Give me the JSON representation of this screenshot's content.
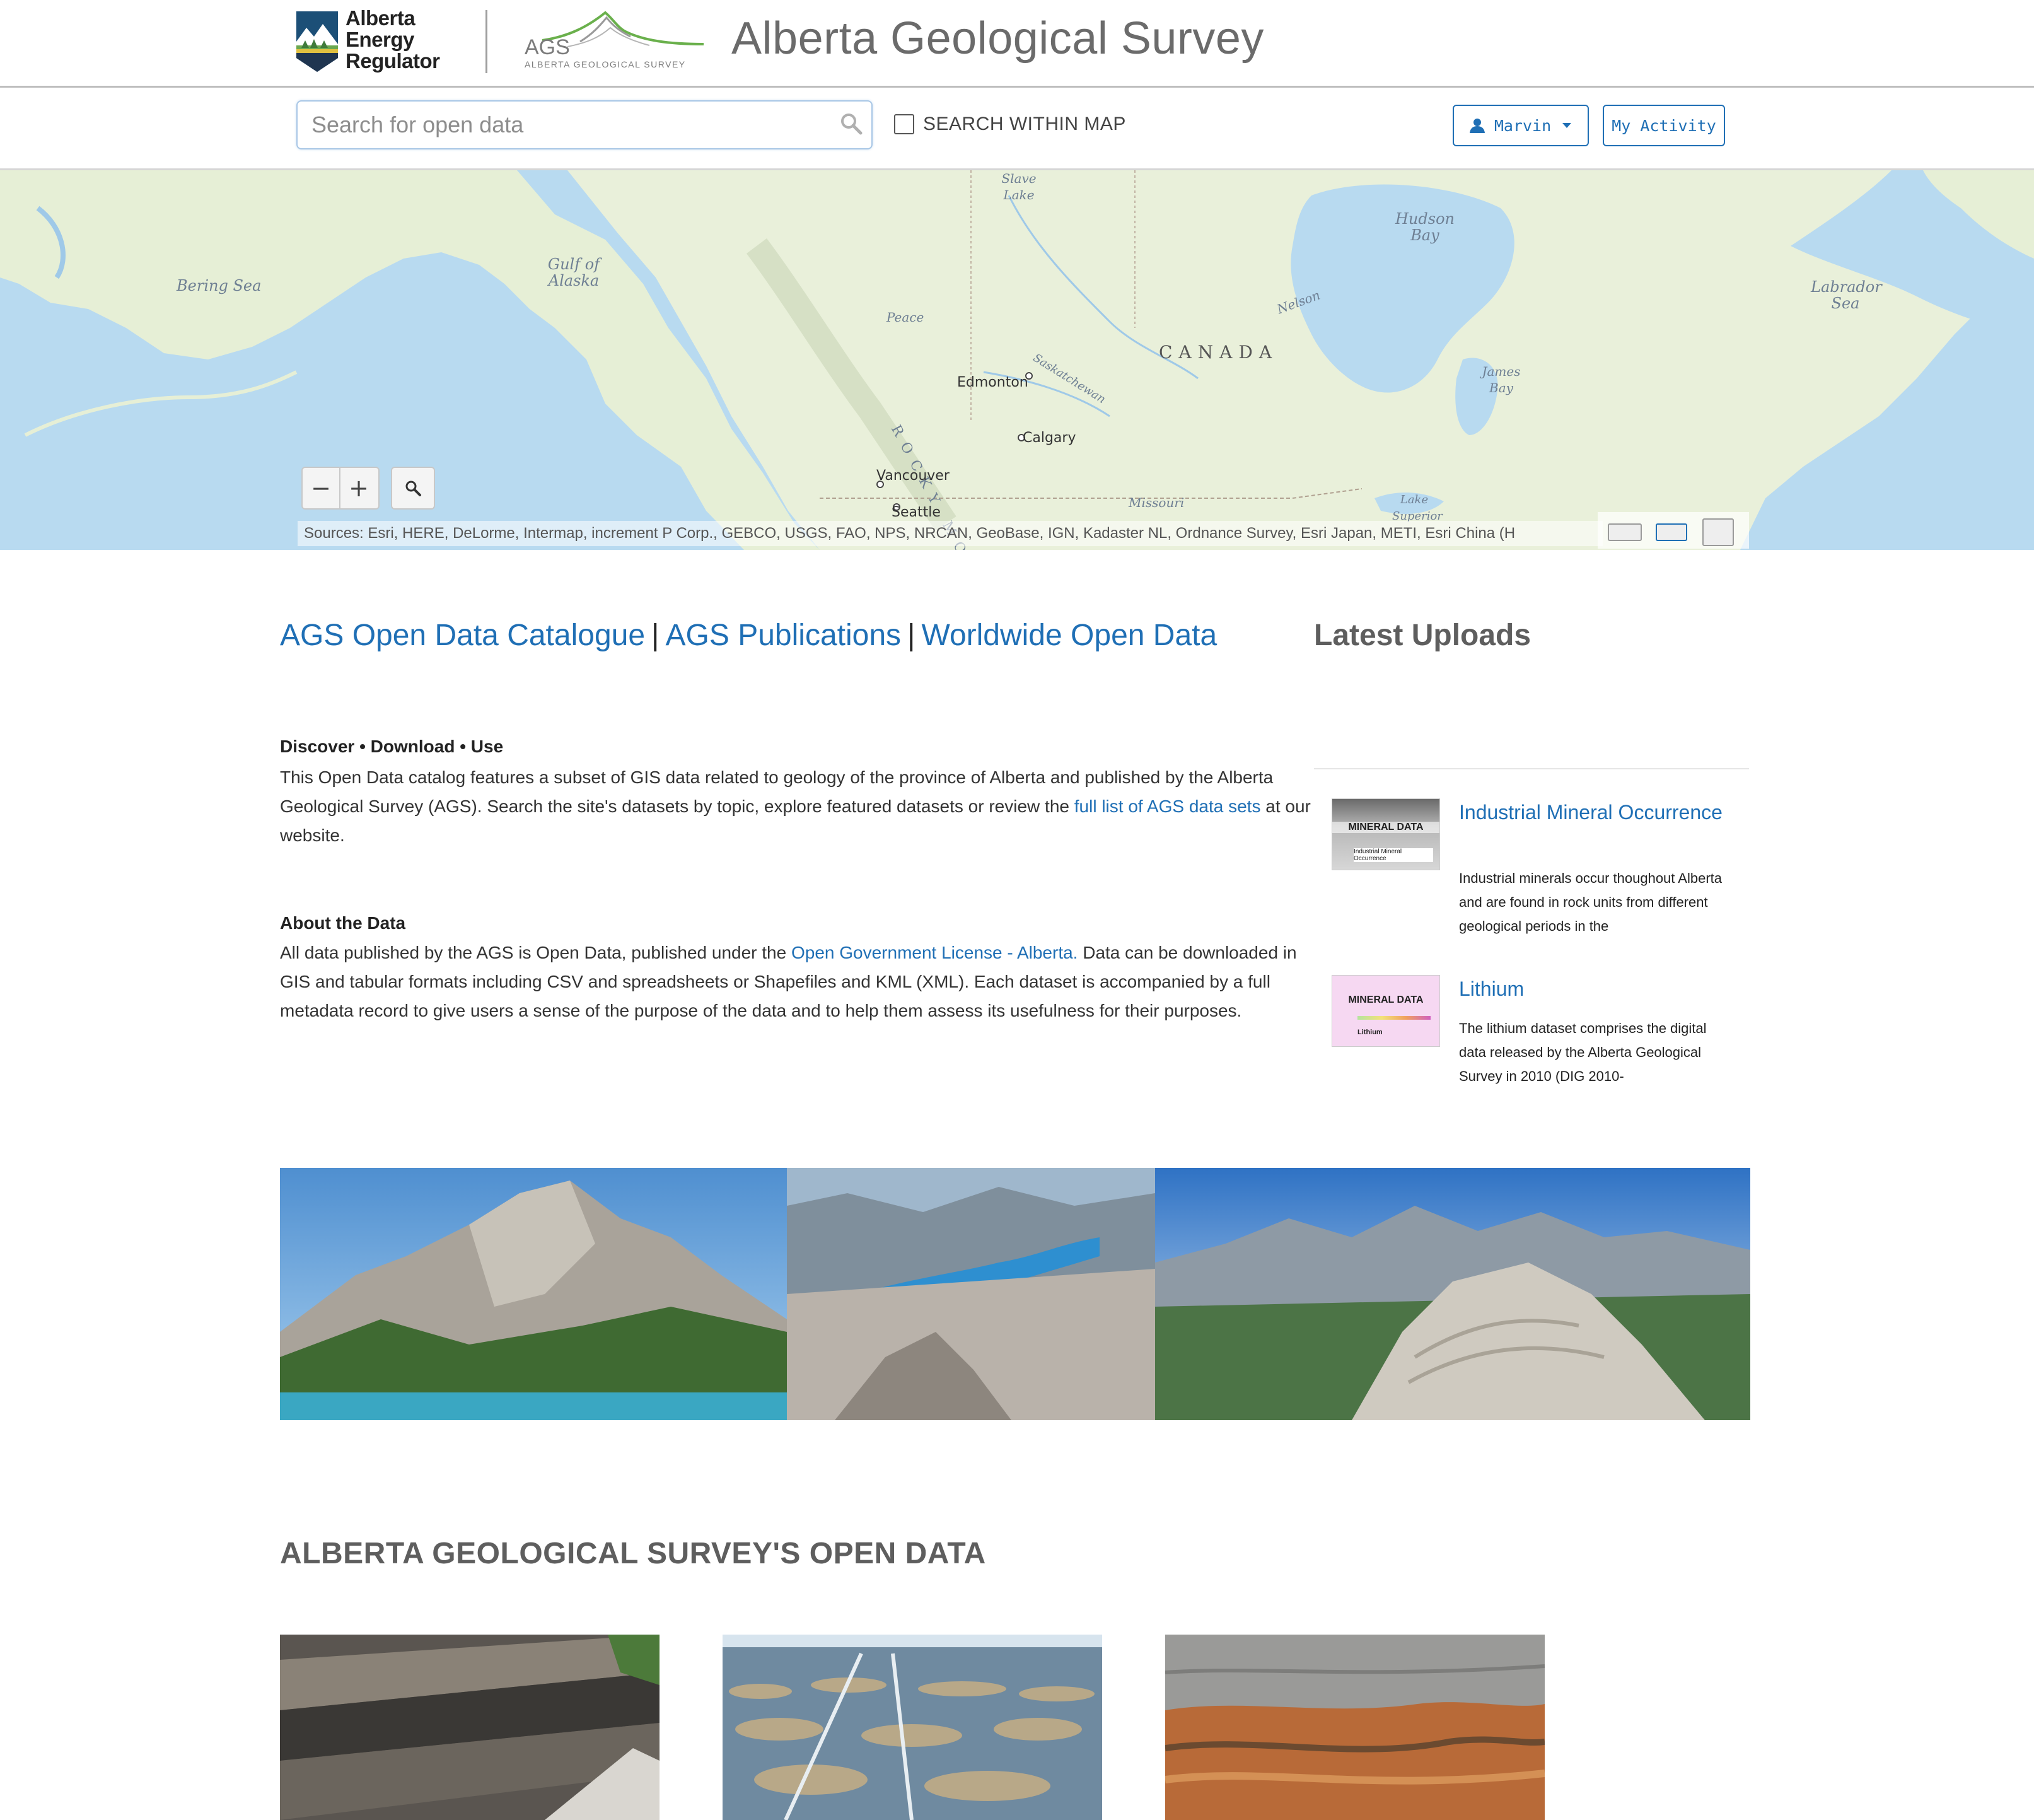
{
  "header": {
    "aer_logo_lines": [
      "Alberta",
      "Energy",
      "Regulator"
    ],
    "ags_logo_text": "AGS",
    "ags_logo_sub": "ALBERTA GEOLOGICAL SURVEY",
    "site_title": "Alberta Geological Survey"
  },
  "search": {
    "placeholder": "Search for open data",
    "within_map_label": "SEARCH WITHIN MAP",
    "within_map_checked": false,
    "user_button": "Marvin",
    "activity_button": "My Activity"
  },
  "map": {
    "labels": {
      "bering": "Bering Sea",
      "alaska": "Gulf of Alaska",
      "hudson": "Hudson Bay",
      "labrador": "Labrador Sea",
      "james": "James Bay",
      "country": "CANADA",
      "slave": "Slave Lake",
      "nelson": "Nelson",
      "peace": "Peace",
      "saskatchewan": "Saskatchewan",
      "missouri": "Missouri",
      "superior": "Lake Superior",
      "rocky": "ROCKY MO"
    },
    "cities": {
      "edmonton": "Edmonton",
      "calgary": "Calgary",
      "vancouver": "Vancouver",
      "seattle": "Seattle"
    },
    "zoom_out": "−",
    "zoom_in": "+",
    "attribution": "Sources: Esri, HERE, DeLorme, Intermap, increment P Corp., GEBCO, USGS, FAO, NPS, NRCAN, GeoBase, IGN, Kadaster NL, Ordnance Survey, Esri Japan, METI, Esri China (H"
  },
  "main": {
    "links": [
      "AGS Open Data Catalogue",
      "AGS Publications",
      "Worldwide Open Data"
    ],
    "link_separator": "|",
    "intro_heading": "Discover • Download • Use",
    "intro_text_1": "This Open Data catalog features a subset of GIS data related to geology of the province of Alberta and published by the Alberta Geological Survey (AGS). Search the site's datasets by topic, explore featured datasets or review the ",
    "intro_link": "full list of AGS data sets",
    "intro_text_2": " at our website.",
    "about_heading": "About the Data",
    "about_text_1": "All data published by the AGS is Open Data, published under the ",
    "about_link": "Open Government License - Alberta.",
    "about_text_2": " Data can be downloaded in GIS and tabular formats including CSV and spreadsheets or Shapefiles and KML (XML). Each dataset is accompanied by a full metadata record to give users a sense of the purpose of the data and to help them assess its usefulness for their purposes."
  },
  "latest": {
    "title": "Latest Uploads",
    "items": [
      {
        "title": "Industrial Mineral Occurrence",
        "thumb_header": "MINERAL DATA",
        "thumb_caption": "Industrial Mineral Occurrence",
        "description": "Industrial minerals occur thoughout Alberta and are found in rock units from different geological periods in the"
      },
      {
        "title": "Lithium",
        "thumb_header": "MINERAL DATA",
        "thumb_caption": "Lithium",
        "description": "The lithium dataset comprises the digital data released by the Alberta Geological Survey in 2010 (DIG 2010-"
      }
    ]
  },
  "open_data": {
    "title": "ALBERTA GEOLOGICAL SURVEY'S OPEN DATA"
  },
  "colors": {
    "link": "#1f6fb5",
    "heading_grey": "#5e5e5e",
    "water": "#b8daf0",
    "land": "#e6efd6"
  },
  "icons": {
    "search": "magnifier-icon",
    "user": "user-icon",
    "caret": "caret-down-icon"
  }
}
